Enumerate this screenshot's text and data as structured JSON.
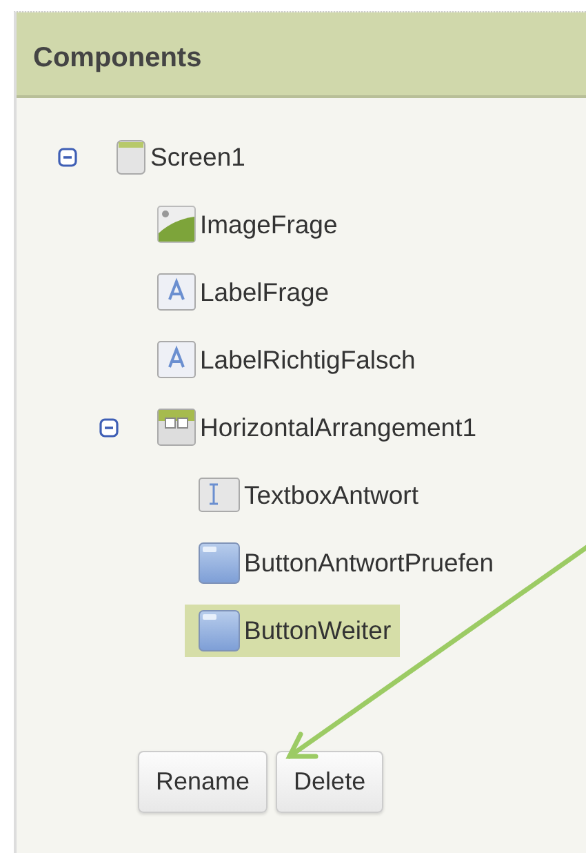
{
  "panel": {
    "title": "Components"
  },
  "tree": [
    {
      "label": "Screen1",
      "kind": "screen",
      "selected": false,
      "expanded": true,
      "children": [
        {
          "label": "ImageFrage",
          "kind": "image",
          "selected": false
        },
        {
          "label": "LabelFrage",
          "kind": "label",
          "selected": false
        },
        {
          "label": "LabelRichtigFalsch",
          "kind": "label",
          "selected": false
        },
        {
          "label": "HorizontalArrangement1",
          "kind": "arrangement",
          "selected": false,
          "expanded": true,
          "children": [
            {
              "label": "TextboxAntwort",
              "kind": "textbox",
              "selected": false
            },
            {
              "label": "ButtonAntwortPruefen",
              "kind": "button",
              "selected": false
            },
            {
              "label": "ButtonWeiter",
              "kind": "button",
              "selected": true
            }
          ]
        }
      ]
    }
  ],
  "buttons": [
    "Rename",
    "Delete"
  ]
}
